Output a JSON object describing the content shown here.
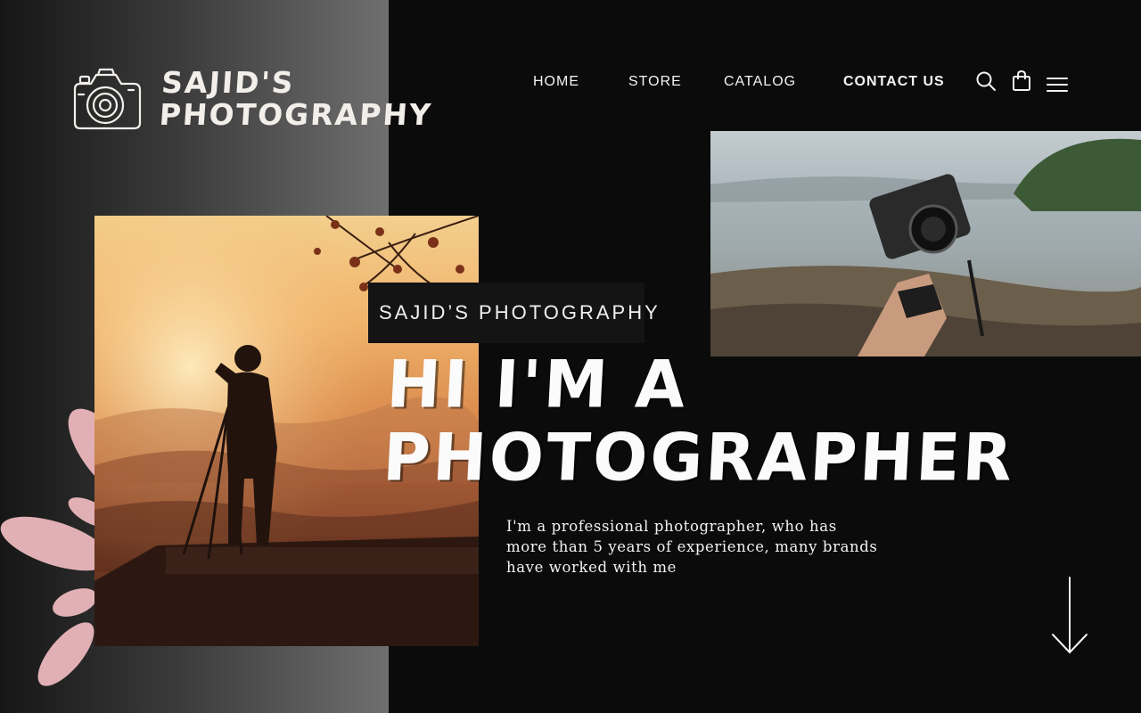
{
  "brand": {
    "name_line1": "SAJID'S",
    "name_line2": "PHOTOGRAPHY",
    "logo_icon": "camera-icon"
  },
  "nav": {
    "items": [
      {
        "label": "HOME"
      },
      {
        "label": "STORE"
      },
      {
        "label": "CATALOG"
      },
      {
        "label": "CONTACT US"
      }
    ],
    "icons": [
      "search-icon",
      "shopping-bag-icon",
      "hamburger-menu-icon"
    ]
  },
  "hero": {
    "tag": "SAJID’S PHOTOGRAPHY",
    "headline_line1": "HI I'M A",
    "headline_line2": "PHOTOGRAPHER",
    "intro": "I'm a professional photographer, who has more than 5 years of experience, many brands have worked with me"
  },
  "colors": {
    "background": "#0b0b0b",
    "accent_splash": "#e1b0b4",
    "panel_gradient_start": "#161616",
    "panel_gradient_end": "#6f6f6f"
  },
  "scroll": {
    "icon": "arrow-down-icon"
  }
}
